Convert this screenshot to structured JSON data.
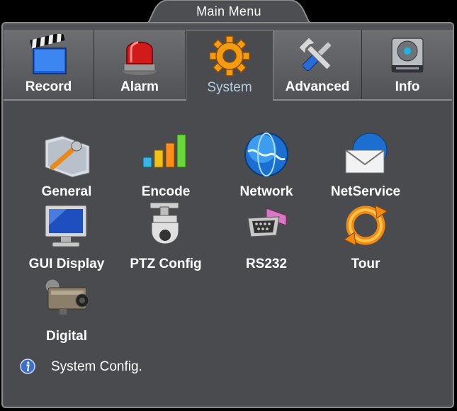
{
  "window": {
    "title": "Main Menu"
  },
  "tabs": [
    {
      "id": "record",
      "label": "Record",
      "icon": "clapperboard-icon"
    },
    {
      "id": "alarm",
      "label": "Alarm",
      "icon": "siren-icon"
    },
    {
      "id": "system",
      "label": "System",
      "icon": "gear-icon",
      "active": true
    },
    {
      "id": "advanced",
      "label": "Advanced",
      "icon": "tools-icon"
    },
    {
      "id": "info",
      "label": "Info",
      "icon": "hard-drive-icon"
    }
  ],
  "items": [
    {
      "id": "general",
      "label": "General",
      "icon": "general-settings-icon"
    },
    {
      "id": "encode",
      "label": "Encode",
      "icon": "bar-chart-icon"
    },
    {
      "id": "network",
      "label": "Network",
      "icon": "globe-icon"
    },
    {
      "id": "netservice",
      "label": "NetService",
      "icon": "envelope-icon"
    },
    {
      "id": "gui-display",
      "label": "GUI Display",
      "icon": "monitor-icon"
    },
    {
      "id": "ptz-config",
      "label": "PTZ Config",
      "icon": "dome-camera-icon"
    },
    {
      "id": "rs232",
      "label": "RS232",
      "icon": "serial-port-icon"
    },
    {
      "id": "tour",
      "label": "Tour",
      "icon": "cycle-arrows-icon"
    },
    {
      "id": "digital",
      "label": "Digital",
      "icon": "camera-icon"
    }
  ],
  "status": {
    "text": "System Config.",
    "icon": "info-icon"
  },
  "colors": {
    "accent": "#b8cbe4",
    "panel": "#4a4b4e",
    "background": "#000000"
  }
}
